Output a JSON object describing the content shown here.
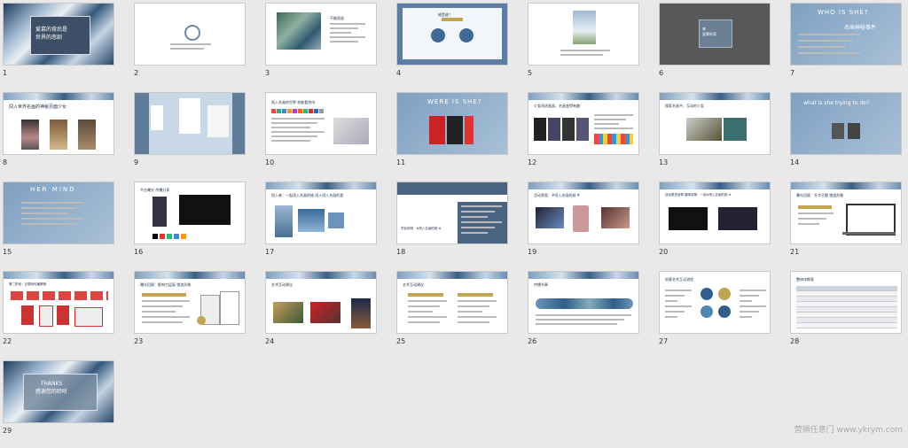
{
  "slides": [
    {
      "n": "1",
      "kind": "cover",
      "text": "爱慕的背后是\n世界的悲剧"
    },
    {
      "n": "2",
      "kind": "ring",
      "text": ""
    },
    {
      "n": "3",
      "kind": "painting",
      "text": "不能再说"
    },
    {
      "n": "4",
      "kind": "circles",
      "text": "她是谁？",
      "chips": [
        "她是谁",
        "是谁",
        "才是谁"
      ]
    },
    {
      "n": "5",
      "kind": "portrait",
      "text": ""
    },
    {
      "n": "6",
      "kind": "dark",
      "text": "感\n爱慕的背"
    },
    {
      "n": "7",
      "kind": "who",
      "text": "WHO IS SHE?",
      "sub": "名画神秘事件"
    },
    {
      "n": "8",
      "kind": "three",
      "text": "闯入世界名画的神秘页面少女"
    },
    {
      "n": "9",
      "kind": "phones",
      "text": ""
    },
    {
      "n": "10",
      "kind": "icons",
      "text": "闯入名画的世界 你能看到吗"
    },
    {
      "n": "11",
      "kind": "were",
      "text": "WERE IS SHE?"
    },
    {
      "n": "12",
      "kind": "row",
      "text": "少女闯进画面，名画变得有趣"
    },
    {
      "n": "13",
      "kind": "teal",
      "text": "搜索名画中，互动的少女"
    },
    {
      "n": "14",
      "kind": "what",
      "text": "what is she trying to do?"
    },
    {
      "n": "15",
      "kind": "mind",
      "text": "HER MIND"
    },
    {
      "n": "16",
      "kind": "darkphone",
      "text": "平台曝光 传播分享"
    },
    {
      "n": "17",
      "kind": "bluepanels",
      "text": "闯入者：一起闯入名画的她 闯入闯入名画的夏"
    },
    {
      "n": "18",
      "kind": "split",
      "text": "项目说明：#闯入名画的她 #"
    },
    {
      "n": "19",
      "kind": "three2",
      "text": "活动界面：#闯入名画的她 #"
    },
    {
      "n": "20",
      "kind": "two",
      "text": "活动更多延伸 趣味视角：一起#闯入名画的她 #"
    },
    {
      "n": "21",
      "kind": "laptop",
      "text": "曝光回顾：升华主题 塑造形象"
    },
    {
      "n": "22",
      "kind": "reds",
      "text": "第二阶段：互联网传播策略"
    },
    {
      "n": "23",
      "kind": "bars",
      "text": "曝光回顾：影响力层面 塑造形象"
    },
    {
      "n": "24",
      "kind": "arts",
      "text": "艺术互动建议"
    },
    {
      "n": "25",
      "kind": "golds",
      "text": "艺术互动建议"
    },
    {
      "n": "26",
      "kind": "flow",
      "text": "传播节奏"
    },
    {
      "n": "27",
      "kind": "cycle",
      "text": "创意艺术互动流程"
    },
    {
      "n": "28",
      "kind": "table",
      "text": "整体排期表"
    },
    {
      "n": "29",
      "kind": "end",
      "text": "THANKS\n感谢您的聆听"
    }
  ],
  "watermark": "营销任意门 www.ykrym.com",
  "colors": {
    "accent": "#4a6e95",
    "bg": "#e9e9e9"
  }
}
